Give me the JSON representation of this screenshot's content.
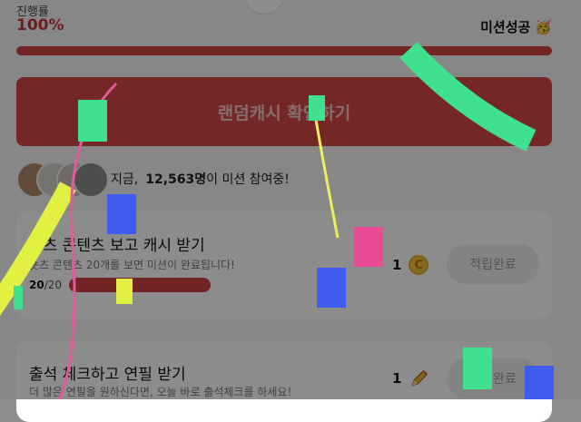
{
  "progress": {
    "label": "진행률",
    "value": "100%",
    "percent": 100,
    "status_text": "미션성공",
    "status_emoji": "🥳"
  },
  "cta": {
    "label": "랜덤캐시 확인하기"
  },
  "participants": {
    "prefix": "지금,",
    "count": "12,563명",
    "suffix": "이 미션 참여중!"
  },
  "missions": [
    {
      "title": "숏츠 콘텐츠 보고 캐시 받기",
      "subtitle": "숏츠 콘텐츠 20개를 보면 미션이 완료됩니다!",
      "progress_done": "20",
      "progress_total": "/20",
      "reward": "1",
      "reward_icon": "coin-icon",
      "button_label": "적립완료"
    },
    {
      "title": "출석 체크하고 연필 받기",
      "subtitle": "더 많은 연필을 원하신다면, 오늘 바로 출석체크를 하세요!",
      "reward": "1",
      "reward_icon": "pencil-icon",
      "button_label": "적립완료"
    }
  ],
  "colors": {
    "accent_red": "#d24242",
    "overlay": "rgba(0,0,0,0.45)"
  }
}
